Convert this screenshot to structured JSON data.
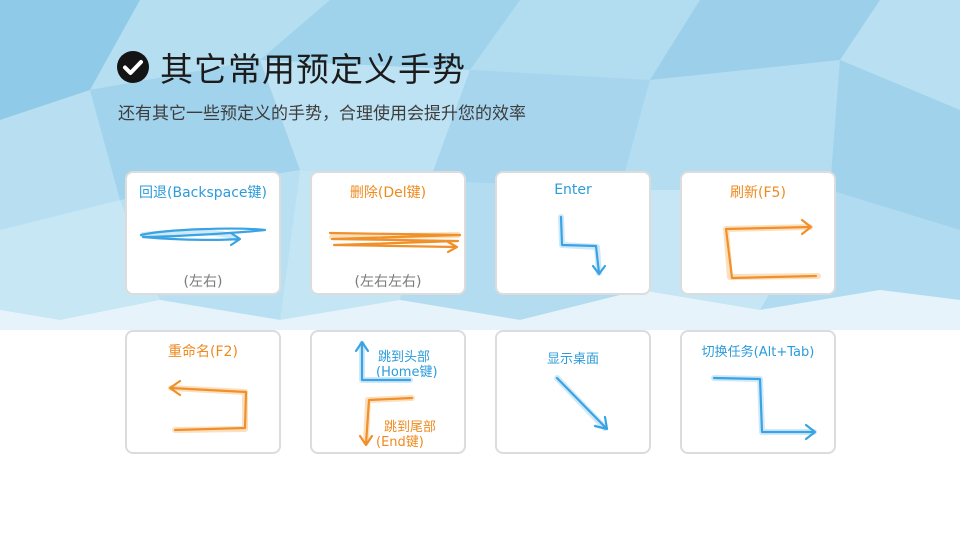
{
  "header": {
    "title": "其它常用预定义手势",
    "subtitle": "还有其它一些预定义的手势，合理使用会提升您的效率"
  },
  "colors": {
    "blue": "#2b9cdb",
    "orange": "#ee8a1e",
    "grey": "#7a7a7a",
    "card_border": "#dcdcdc",
    "bg_blue": "#a9d8ee"
  },
  "gestures": [
    {
      "label": "回退(Backspace键)",
      "note": "(左右)",
      "color": "blue",
      "icon": "arrow-right-stroke"
    },
    {
      "label": "删除(Del键)",
      "note": "(左右左右)",
      "color": "orange",
      "icon": "zigzag-horizontal-stroke"
    },
    {
      "label": "Enter",
      "color": "blue",
      "icon": "down-right-down-stroke"
    },
    {
      "label": "刷新(F5)",
      "color": "orange",
      "icon": "refresh-stroke"
    },
    {
      "label": "重命名(F2)",
      "color": "orange",
      "icon": "return-left-stroke"
    },
    {
      "label_top": "跳到头部",
      "label_top_sub": "(Home键)",
      "label_bottom": "跳到尾部",
      "label_bottom_sub": "(End键)",
      "color": "blue_orange",
      "icon": "up-down-stroke"
    },
    {
      "label": "显示桌面",
      "color": "blue",
      "icon": "diagonal-down-right-stroke"
    },
    {
      "label": "切换任务(Alt+Tab)",
      "color": "blue",
      "icon": "switch-task-stroke"
    }
  ]
}
